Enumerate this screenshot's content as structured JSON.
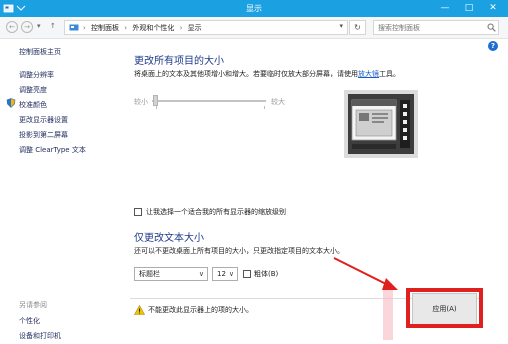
{
  "window": {
    "title": "显示",
    "min_glyph": "—",
    "max_glyph": "□",
    "close_glyph": "✕"
  },
  "nav": {
    "back_glyph": "←",
    "forward_glyph": "→",
    "dropdown_glyph": "▾",
    "up_glyph": "↑",
    "breadcrumbs": [
      "控制面板",
      "外观和个性化",
      "显示"
    ],
    "crumb_separator": "›",
    "address_dropdown_glyph": "▾",
    "refresh_glyph": "↻",
    "search_placeholder": "搜索控制面板"
  },
  "sidebar": {
    "links": [
      "控制面板主页",
      "调整分辨率",
      "调整亮度",
      "校准颜色",
      "更改显示器设置",
      "投影到第二屏幕",
      "调整 ClearType 文本"
    ],
    "see_also_label": "另请参阅",
    "see_also_links": [
      "个性化",
      "设备和打印机"
    ]
  },
  "help_glyph": "?",
  "main": {
    "section1_title": "更改所有项目的大小",
    "section1_text": "将桌面上的文本及其他项增小和增大。若要临时仅放大部分屏幕，请使用",
    "magnifier_link": "放大镜",
    "section1_suffix": "工具。",
    "slider_min_label": "较小",
    "slider_max_label": "较大",
    "slider_level": 0,
    "checkbox_all_displays": "让我选择一个适合我的所有显示器的缩放级别",
    "section2_title": "仅更改文本大小",
    "section2_text": "还可以不更改桌面上所有项目的大小，只更改指定项目的文本大小。",
    "item_select_value": "标题栏",
    "size_select_value": "12",
    "select_caret": "∨",
    "bold_label": "粗体(B)",
    "warning_text": "不能更改此显示器上的项的大小。",
    "apply_label": "应用(A)"
  },
  "colors": {
    "titlebar": "#1ba1e2",
    "highlight_red": "#e0201e",
    "heading_blue": "#1e3a8a",
    "link_blue": "#1a5dc9"
  }
}
